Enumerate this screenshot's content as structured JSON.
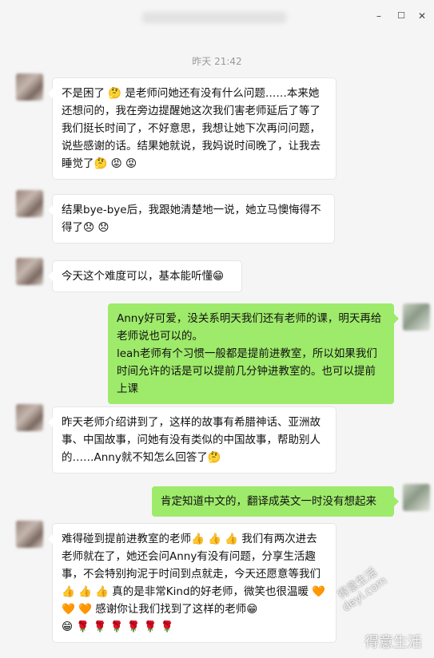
{
  "window": {
    "minimize_glyph": "–",
    "maximize_glyph": "☐",
    "close_glyph": "✕"
  },
  "timestamp": "昨天 21:42",
  "messages": [
    {
      "side": "left",
      "text": "不是困了 🤔 是老师问她还有没有什么问题……本来她还想问的，我在旁边提醒她这次我们害老师延后了等了我们挺长时间了，不好意思，我想让她下次再问问题，说些感谢的话。结果她就说，我妈说时间晚了，让我去睡觉了🤔 😡 😡"
    },
    {
      "side": "left",
      "text": "结果bye-bye后，我跟她清楚地一说，她立马懊悔得不得了😞 😞"
    },
    {
      "side": "left",
      "text": "今天这个难度可以，基本能听懂😁"
    },
    {
      "side": "right",
      "text": "Anny好可爱，没关系明天我们还有老师的课，明天再给老师说也可以的。",
      "text2": "leah老师有个习惯一般都是提前进教室，所以如果我们时间允许的话是可以提前几分钟进教室的。也可以提前上课"
    },
    {
      "side": "left",
      "text": "昨天老师介绍讲到了，这样的故事有希腊神话、亚洲故事、中国故事，问她有没有类似的中国故事，帮助别人的……Anny就不知怎么回答了🤔"
    },
    {
      "side": "right",
      "text": "肯定知道中文的，翻译成英文一时没有想起来"
    },
    {
      "side": "left",
      "text": "难得碰到提前进教室的老师👍 👍 👍 我们有两次进去老师就在了，她还会问Anny有没有问题，分享生活趣事，不会特别拘泥于时间到点就走，今天还愿意等我们👍 👍 👍 真的是非常Kind的好老师，微笑也很温暖 🧡 🧡 🧡 感谢你让我们找到了这样的老师😁",
      "text2": "😁 🌹 🌹 🌹 🌹 🌹 🌹"
    }
  ],
  "watermark": {
    "main": "得意生活",
    "rotated_line1": "得意生活",
    "rotated_line2": "deyi.com"
  }
}
